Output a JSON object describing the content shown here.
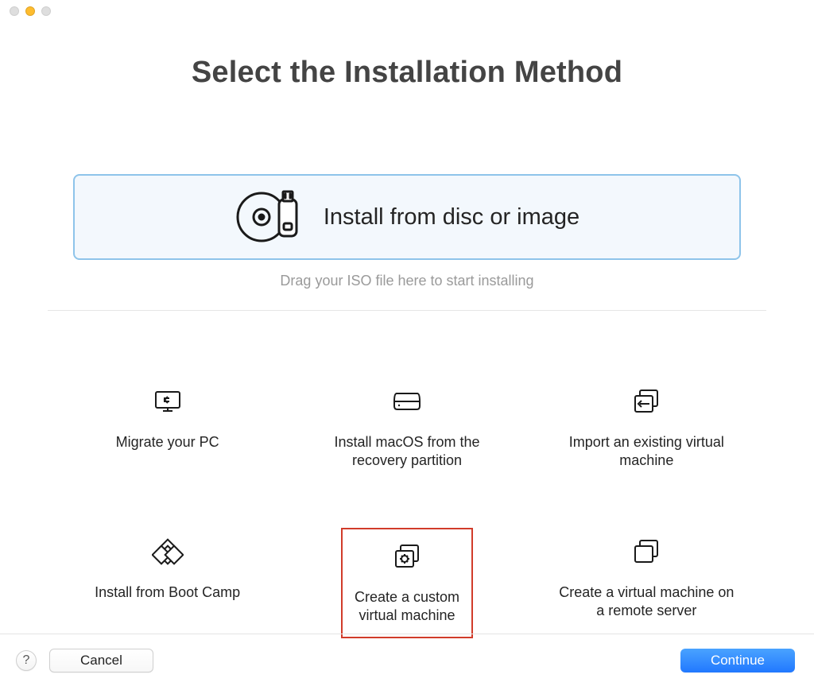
{
  "window": {
    "title": "Select the Installation Method"
  },
  "primary_option": {
    "label": "Install from disc or image",
    "hint": "Drag your ISO file here to start installing"
  },
  "options": [
    {
      "id": "migrate",
      "label": "Migrate your PC"
    },
    {
      "id": "macos-recovery",
      "label": "Install macOS from the recovery partition"
    },
    {
      "id": "import",
      "label": "Import an existing virtual machine"
    },
    {
      "id": "bootcamp",
      "label": "Install from Boot Camp"
    },
    {
      "id": "custom",
      "label": "Create a custom virtual machine",
      "highlighted": true
    },
    {
      "id": "remote",
      "label": "Create a virtual machine on a remote server"
    }
  ],
  "footer": {
    "help": "?",
    "cancel": "Cancel",
    "continue": "Continue"
  }
}
